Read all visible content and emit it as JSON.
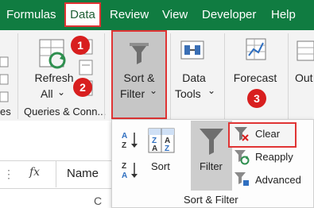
{
  "tabs": [
    {
      "label": "Formulas"
    },
    {
      "label": "Data"
    },
    {
      "label": "Review"
    },
    {
      "label": "View"
    },
    {
      "label": "Developer"
    },
    {
      "label": "Help"
    }
  ],
  "ribbon": {
    "refresh_all_line1": "Refresh",
    "refresh_all_line2": "All",
    "queries_group_label": "Queries & Conn...",
    "sort_filter_line1": "Sort &",
    "sort_filter_line2": "Filter",
    "data_tools_line1": "Data",
    "data_tools_line2": "Tools",
    "forecast_label": "Forecast",
    "outline_label": "Out",
    "partial_left_label": "es"
  },
  "badges": [
    "1",
    "2",
    "3"
  ],
  "dropdown": {
    "sort_label": "Sort",
    "filter_label": "Filter",
    "clear_label": "Clear",
    "reapply_label": "Reapply",
    "advanced_label": "Advanced",
    "group_label": "Sort & Filter"
  },
  "formula_bar": {
    "fx_label": "fx",
    "namebox_value": "Name",
    "partial_column": "C"
  },
  "colors": {
    "accent": "#107c41",
    "highlight": "#e03434",
    "badge": "#d81f1f"
  }
}
